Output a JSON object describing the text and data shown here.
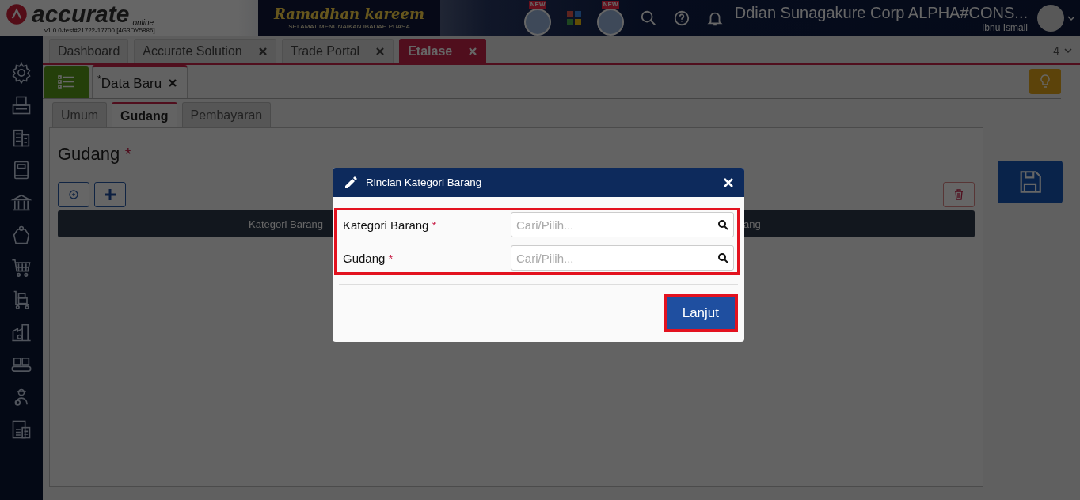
{
  "header": {
    "logo": "accurate",
    "logo_sub": "online",
    "version": "v1.0.0-test#21722-17700 [4G3DY5886]",
    "banner_title": "Ramadhan kareem",
    "banner_subtitle": "SELAMAT MENUNAIKAN IBADAH PUASA",
    "badges": [
      "NEW",
      "NEW"
    ],
    "company": "Ddian Sunagakure Corp ALPHA#CONS...",
    "user": "Ibnu Ismail"
  },
  "tabs": [
    {
      "label": "Dashboard",
      "closable": false,
      "selected": false
    },
    {
      "label": "Accurate Solution",
      "closable": true,
      "selected": false
    },
    {
      "label": "Trade Portal",
      "closable": true,
      "selected": false
    },
    {
      "label": "Etalase",
      "closable": true,
      "selected": true
    }
  ],
  "tab_count": "4",
  "doc_tab": {
    "label": "Data Baru",
    "modified_mark": "*"
  },
  "sub_tabs": [
    {
      "label": "Umum",
      "selected": false
    },
    {
      "label": "Gudang",
      "selected": true
    },
    {
      "label": "Pembayaran",
      "selected": false
    }
  ],
  "section": {
    "title": "Gudang",
    "required_mark": "*"
  },
  "table": {
    "columns": [
      "Kategori Barang",
      "ang"
    ]
  },
  "modal": {
    "title": "Rincian Kategori Barang",
    "highlighted": true,
    "fields": [
      {
        "label": "Kategori Barang",
        "required_mark": "*",
        "placeholder": "Cari/Pilih..."
      },
      {
        "label": "Gudang",
        "required_mark": "*",
        "placeholder": "Cari/Pilih..."
      }
    ],
    "button": {
      "label": "Lanjut",
      "highlighted": true
    }
  }
}
